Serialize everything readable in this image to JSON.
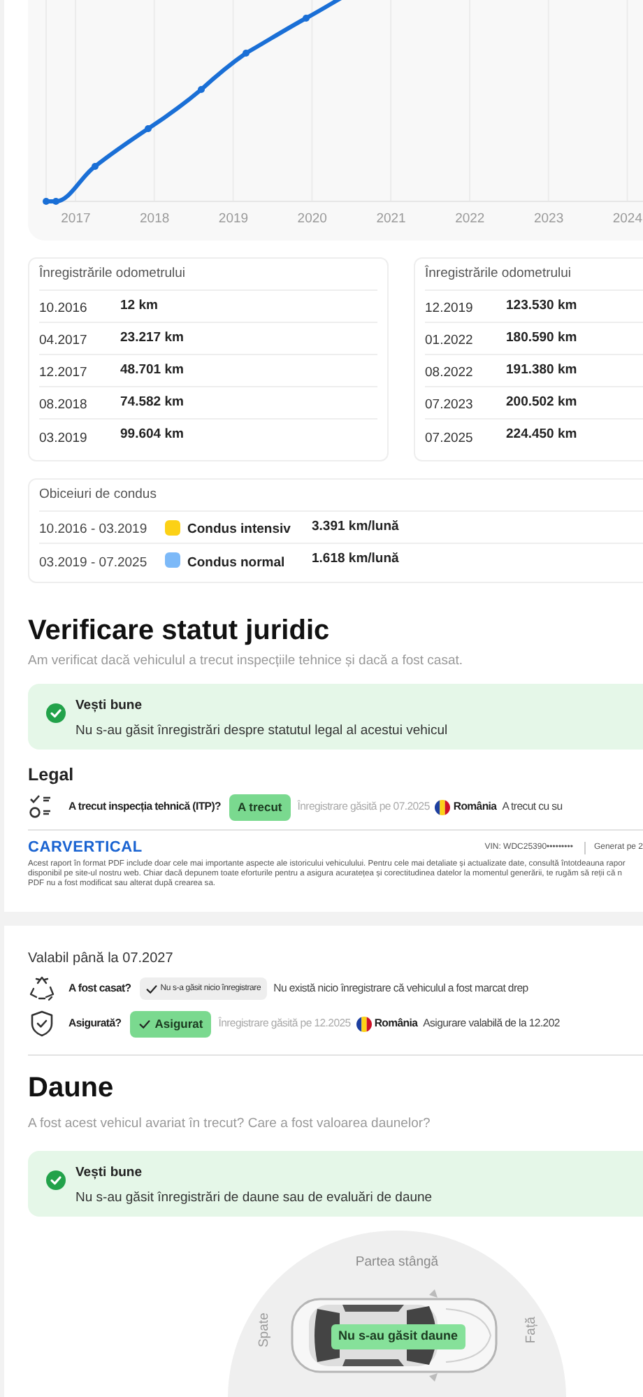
{
  "mileage_chart": {
    "x_axis_labels": [
      "2017",
      "2018",
      "2019",
      "2020",
      "2021",
      "2022",
      "2023",
      "2024"
    ]
  },
  "odometer_tables": [
    {
      "title": "Înregistrările odometrului",
      "rows": [
        {
          "date": "10.2016",
          "mileage": "12 km"
        },
        {
          "date": "04.2017",
          "mileage": "23.217 km"
        },
        {
          "date": "12.2017",
          "mileage": "48.701 km"
        },
        {
          "date": "08.2018",
          "mileage": "74.582 km"
        },
        {
          "date": "03.2019",
          "mileage": "99.604 km"
        }
      ]
    },
    {
      "title": "Înregistrările odometrului",
      "rows": [
        {
          "date": "12.2019",
          "mileage": "123.530 km"
        },
        {
          "date": "01.2022",
          "mileage": "180.590 km"
        },
        {
          "date": "08.2022",
          "mileage": "191.380 km"
        },
        {
          "date": "07.2023",
          "mileage": "200.502 km"
        },
        {
          "date": "07.2025",
          "mileage": "224.450 km"
        }
      ]
    }
  ],
  "driving_habits": {
    "title": "Obiceiuri de condus",
    "rows": [
      {
        "period": "10.2016 - 03.2019",
        "color": "#fcd116",
        "label": "Condus intensiv",
        "rate": "3.391 km/lună"
      },
      {
        "period": "03.2019 - 07.2025",
        "color": "#7cb9f8",
        "label": "Condus normal",
        "rate": "1.618 km/lună"
      }
    ]
  },
  "legal_section": {
    "heading": "Verificare statut juridic",
    "subtitle": "Am verificat dacă vehiculul a trecut inspecțiile tehnice și dacă a fost casat.",
    "notice": {
      "title": "Vești bune",
      "text": "Nu s-au găsit înregistrări despre statutul legal al acestui vehicul"
    },
    "legal_title": "Legal",
    "items": [
      {
        "kind": "inspection",
        "question": "A trecut inspecția tehnică (ITP)?",
        "badge": "A trecut",
        "color": "#7ad98f",
        "badge_check": false,
        "found": "Înregistrare găsită pe 07.2025",
        "country": "România",
        "note": "A trecut cu su"
      }
    ]
  },
  "page_footer": {
    "logo": "CARVERTICAL",
    "vin": "VIN: WDC25390•••••••••",
    "generated": "Generat pe 2",
    "disclaimer_lines": [
      "Acest raport în format PDF include doar cele mai importante aspecte ale istoricului vehiculului. Pentru cele mai detaliate și actualizate date, consultă întotdeauna rapor",
      "disponibil pe site-ul nostru web. Chiar dacă depunem toate eforturile pentru a asigura acuratețea și corectitudinea datelor la momentul generării, te rugăm să reții că n",
      "PDF nu a fost modificat sau alterat după crearea sa."
    ]
  },
  "legal_continued": {
    "validity": "Valabil până la 07.2027",
    "items": [
      {
        "kind": "scrapped",
        "question": "A fost casat?",
        "badge": "Nu s-a găsit nicio înregistrare",
        "color": "#eeeeee",
        "badge_check": true,
        "note": "Nu există nicio înregistrare că vehiculul a fost marcat drep"
      },
      {
        "kind": "insurance",
        "question": "Asigurată?",
        "badge": "Asigurat",
        "color": "#7ad98f",
        "badge_check": true,
        "found": "Înregistrare găsită pe 12.2025",
        "country": "România",
        "note": "Asigurare valabilă de la 12.202"
      }
    ]
  },
  "damage_section": {
    "heading": "Daune",
    "subtitle": "A fost acest vehicul avariat în trecut? Care a fost valoarea daunelor?",
    "notice": {
      "title": "Vești bune",
      "text": "Nu s-au găsit înregistrări de daune sau de evaluări de daune"
    },
    "diagram": {
      "top_label": "Partea stângă",
      "rear_label": "Spate",
      "front_label": "Față",
      "badge": "Nu s-au găsit daune"
    }
  }
}
